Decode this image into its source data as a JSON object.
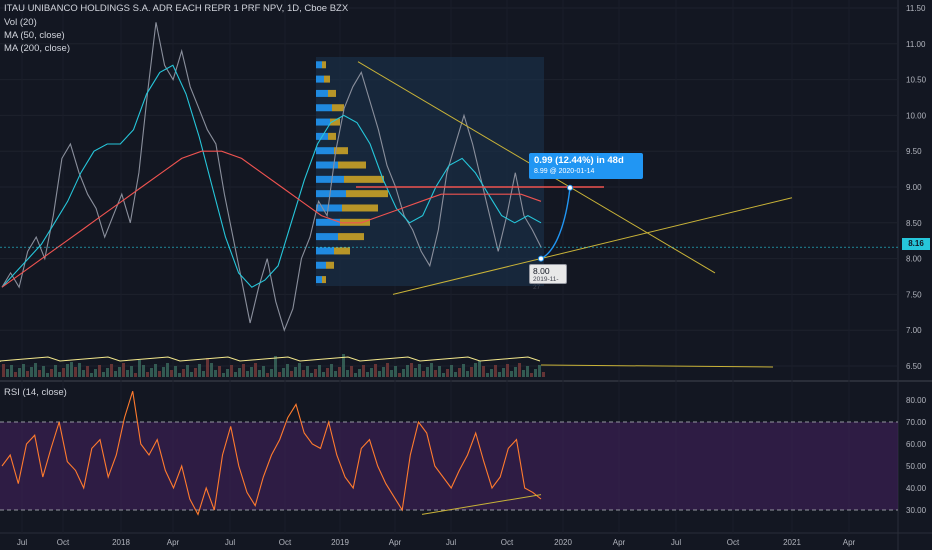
{
  "legend": {
    "title": "ITAU UNIBANCO HOLDINGS S.A. ADR EACH REPR 1 PRF NPV, 1D, Cboe BZX",
    "vol": "Vol (20)",
    "ma50": "MA (50, close)",
    "ma200": "MA (200, close)",
    "rsi": "RSI (14, close)"
  },
  "callout": {
    "line1": "0.99 (12.44%) in 48d",
    "line2": "8.99 @ 2020-01-14"
  },
  "low_tag": {
    "price": "8.00",
    "date": "2019-11-27"
  },
  "last_price": "8.16",
  "colors": {
    "background": "#131722",
    "price": "#5d6270",
    "ma20": "#26c6da",
    "ma200": "#ef5350",
    "trendline": "#c9b338",
    "volume_ma": "#f5e98c",
    "rsi": "#ff7b2e",
    "rsi_band": "#3a1f52",
    "vp_up": "#2196f3",
    "vp_down": "#c9a227",
    "forecast": "#2196f3"
  },
  "chart_data": [
    {
      "type": "line",
      "price_axis": {
        "ticks": [
          "11.50",
          "11.00",
          "10.50",
          "10.00",
          "9.50",
          "9.00",
          "8.50",
          "8.00",
          "7.50",
          "7.00",
          "6.50"
        ],
        "ylim": [
          6.4,
          11.55
        ]
      },
      "time_axis": {
        "ticks": [
          "Jul",
          "Oct",
          "2018",
          "Apr",
          "Jul",
          "Oct",
          "2019",
          "Apr",
          "Jul",
          "Oct",
          "2020",
          "Apr",
          "Jul",
          "Oct",
          "2021",
          "Apr"
        ]
      },
      "series": [
        {
          "values": [
            7.6,
            7.8,
            7.6,
            8.1,
            8.3,
            8.0,
            8.6,
            9.4,
            9.6,
            9.2,
            8.9,
            8.7,
            8.3,
            8.6,
            8.9,
            8.5,
            9.2,
            10.3,
            11.3,
            10.7,
            10.5,
            10.9,
            10.4,
            10.1,
            9.8,
            9.6,
            8.9,
            8.3,
            7.7,
            7.1,
            7.6,
            8.0,
            7.4,
            7.0,
            7.3,
            8.0,
            8.3,
            8.8,
            8.6,
            9.5,
            10.1,
            10.4,
            10.6,
            10.2,
            9.8,
            9.3,
            9.0,
            8.6,
            8.4,
            8.1,
            7.9,
            8.4,
            9.2,
            9.6,
            10.0,
            9.6,
            9.1,
            8.6,
            8.1,
            8.6,
            9.2,
            8.6,
            8.4,
            8.16
          ]
        },
        {
          "name": "MA (50, close)",
          "values": [
            7.6,
            7.8,
            8.0,
            8.2,
            8.5,
            8.8,
            9.2,
            9.5,
            9.6,
            9.6,
            9.8,
            10.3,
            10.6,
            10.7,
            10.3,
            9.7,
            9.0,
            8.3,
            7.8,
            7.6,
            7.7,
            7.9,
            8.5,
            9.1,
            9.6,
            9.9,
            10.0,
            9.9,
            9.6,
            9.1,
            8.7,
            8.5,
            8.6,
            9.0,
            9.3,
            9.4,
            9.2,
            8.9,
            8.6,
            8.5,
            8.6,
            8.5
          ]
        },
        {
          "name": "MA (200, close)",
          "values": [
            7.6,
            7.8,
            8.0,
            8.2,
            8.4,
            8.6,
            8.8,
            9.0,
            9.2,
            9.4,
            9.5,
            9.5,
            9.4,
            9.2,
            9.0,
            8.8,
            8.6,
            8.5,
            8.5,
            8.6,
            8.7,
            8.8,
            8.9,
            8.9,
            8.9,
            8.9,
            8.9,
            8.8
          ]
        }
      ]
    },
    {
      "type": "line",
      "ylim": [
        25,
        85
      ],
      "axis_ticks": [
        "80.00",
        "70.00",
        "60.00",
        "50.00",
        "40.00",
        "30.00"
      ],
      "band": [
        30,
        70
      ],
      "series": [
        {
          "name": "RSI (14, close)",
          "values": [
            50,
            55,
            42,
            60,
            64,
            45,
            58,
            70,
            52,
            48,
            40,
            58,
            62,
            45,
            55,
            72,
            84,
            60,
            55,
            62,
            48,
            40,
            50,
            35,
            28,
            40,
            30,
            55,
            68,
            50,
            38,
            32,
            45,
            55,
            62,
            72,
            78,
            65,
            60,
            58,
            70,
            55,
            45,
            40,
            58,
            62,
            50,
            42,
            36,
            30,
            55,
            70,
            65,
            50,
            45,
            40,
            48,
            55,
            65,
            52,
            40,
            45,
            58,
            62,
            40,
            38,
            35
          ]
        }
      ]
    }
  ]
}
